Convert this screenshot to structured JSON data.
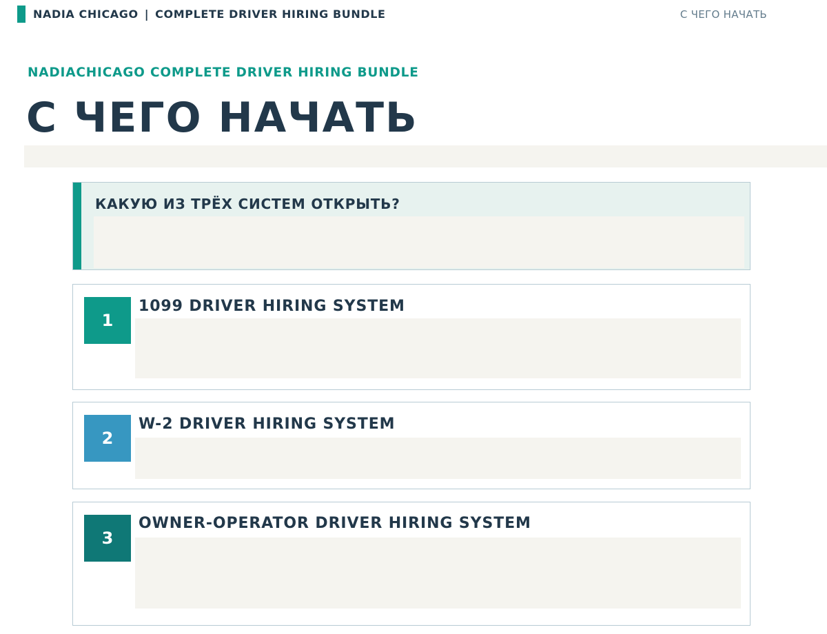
{
  "header": {
    "brand": "NADIA CHICAGO",
    "separator": "|",
    "product": "COMPLETE DRIVER HIRING BUNDLE",
    "section_link": "С ЧЕГО НАЧАТЬ"
  },
  "hero": {
    "eyebrow": "NADIACHICAGO COMPLETE DRIVER HIRING BUNDLE",
    "title": "С ЧЕГО НАЧАТЬ"
  },
  "callout": {
    "title": "КАКУЮ ИЗ ТРЁХ СИСТЕМ ОТКРЫТЬ?"
  },
  "systems": [
    {
      "number": "1",
      "title": "1099 DRIVER HIRING SYSTEM",
      "color": "#0e9a8a"
    },
    {
      "number": "2",
      "title": "W-2 DRIVER HIRING SYSTEM",
      "color": "#3797c1"
    },
    {
      "number": "3",
      "title": "OWNER-OPERATOR DRIVER HIRING SYSTEM",
      "color": "#0f7876"
    }
  ],
  "colors": {
    "accent": "#0e9a8a",
    "heading": "#22384a",
    "muted": "#637c8c",
    "panel": "#f5f4ef",
    "callout_bg": "#e7f2ef",
    "border": "#b7cbd4"
  }
}
